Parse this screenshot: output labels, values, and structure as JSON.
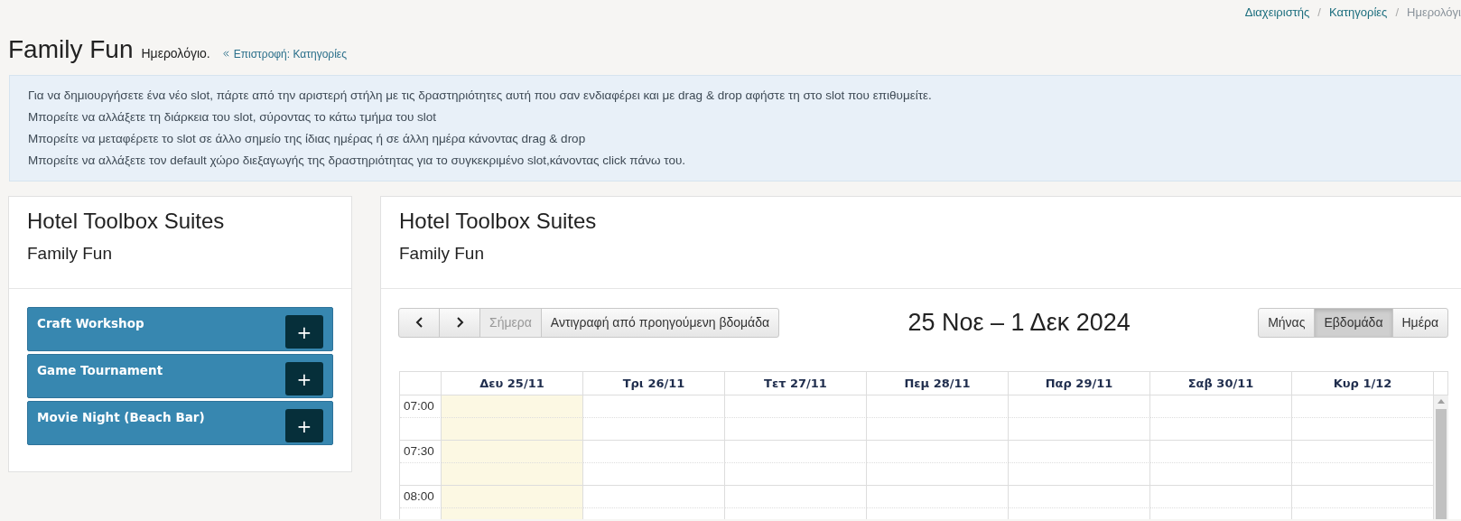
{
  "breadcrumb_separators": [
    "/",
    "/"
  ],
  "breadcrumb": [
    {
      "label": "Διαχειριστής",
      "active": false
    },
    {
      "label": "Κατηγορίες",
      "active": false
    },
    {
      "label": "Ημερολόγι",
      "active": true
    }
  ],
  "header": {
    "title": "Family Fun",
    "subtitle": "Ημερολόγιο.",
    "back_link": "Επιστροφή: Κατηγορίες"
  },
  "info": [
    "Για να δημιουργήσετε ένα νέο slot, πάρτε από την αριστερή στήλη με τις δραστηριότητες αυτή που σαν ενδιαφέρει και με drag & drop αφήστε τη στο slot που επιθυμείτε.",
    "Μπορείτε να αλλάξετε τη διάρκεια του slot, σύροντας το κάτω τμήμα του slot",
    "Μπορείτε να μεταφέρετε το slot σε άλλο σημείο της ίδιας ημέρας ή σε άλλη ημέρα κάνοντας drag & drop",
    "Μπορείτε να αλλάξετε τον default χώρο διεξαγωγής της δραστηριότητας για το συγκεκριμένο slot,κάνοντας click πάνω του."
  ],
  "activities_panel": {
    "title": "Hotel Toolbox Suites",
    "subtitle": "Family Fun",
    "activities": [
      {
        "name": "Craft Workshop",
        "button": "+"
      },
      {
        "name": "Game Tournament",
        "button": "+"
      },
      {
        "name": "Movie Night (Beach Bar)",
        "button": "+"
      }
    ]
  },
  "calendar_panel": {
    "title": "Hotel Toolbox Suites",
    "subtitle": "Family Fun",
    "toolbar": {
      "buttons": [
        {
          "kind": "prev"
        },
        {
          "kind": "next"
        },
        {
          "kind": "text",
          "label": "Σήμερα",
          "disabled": true
        },
        {
          "kind": "text",
          "label": "Αντιγραφή από προηγούμενη βδομάδα",
          "disabled": false
        }
      ],
      "range": "25 Νοε – 1 Δεκ 2024",
      "views": [
        {
          "label": "Μήνας",
          "selected": false
        },
        {
          "label": "Εβδομάδα",
          "selected": true
        },
        {
          "label": "Ημέρα",
          "selected": false
        }
      ]
    },
    "days": [
      {
        "label": "Δευ 25/11",
        "today": true
      },
      {
        "label": "Τρι 26/11",
        "today": false
      },
      {
        "label": "Τετ 27/11",
        "today": false
      },
      {
        "label": "Πεμ 28/11",
        "today": false
      },
      {
        "label": "Παρ 29/11",
        "today": false
      },
      {
        "label": "Σαβ 30/11",
        "today": false
      },
      {
        "label": "Κυρ 1/12",
        "today": false
      }
    ],
    "times": [
      "07:00",
      "07:30",
      "08:00"
    ]
  }
}
